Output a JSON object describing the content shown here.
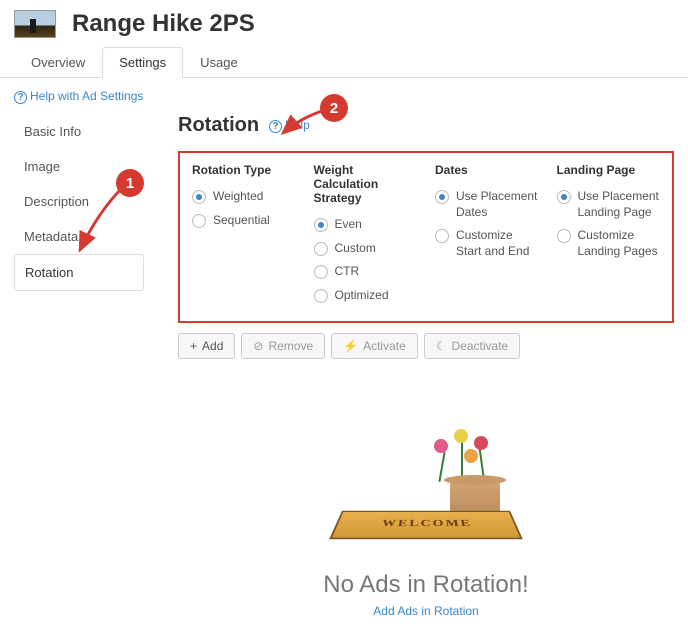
{
  "header": {
    "title": "Range Hike 2PS"
  },
  "tabs": [
    {
      "label": "Overview"
    },
    {
      "label": "Settings"
    },
    {
      "label": "Usage"
    }
  ],
  "activeTab": 1,
  "helpLink": "Help with Ad Settings",
  "sidebar": [
    {
      "label": "Basic Info"
    },
    {
      "label": "Image"
    },
    {
      "label": "Description"
    },
    {
      "label": "Metadata"
    },
    {
      "label": "Rotation"
    }
  ],
  "activeSidebar": 4,
  "section": {
    "title": "Rotation",
    "helpLabel": "Help"
  },
  "columns": {
    "rotationType": {
      "title": "Rotation Type",
      "options": [
        {
          "label": "Weighted",
          "selected": true
        },
        {
          "label": "Sequential",
          "selected": false
        }
      ]
    },
    "weightStrategy": {
      "title": "Weight Calculation Strategy",
      "options": [
        {
          "label": "Even",
          "selected": true
        },
        {
          "label": "Custom",
          "selected": false
        },
        {
          "label": "CTR",
          "selected": false
        },
        {
          "label": "Optimized",
          "selected": false
        }
      ]
    },
    "dates": {
      "title": "Dates",
      "options": [
        {
          "label": "Use Placement Dates",
          "selected": true
        },
        {
          "label": "Customize Start and End",
          "selected": false
        }
      ]
    },
    "landingPage": {
      "title": "Landing Page",
      "options": [
        {
          "label": "Use Placement Landing Page",
          "selected": true
        },
        {
          "label": "Customize Landing Pages",
          "selected": false
        }
      ]
    }
  },
  "actions": {
    "add": "Add",
    "remove": "Remove",
    "activate": "Activate",
    "deactivate": "Deactivate"
  },
  "empty": {
    "matLetters": [
      "W",
      "E",
      "L",
      "C",
      "O",
      "M",
      "E"
    ],
    "heading": "No Ads in Rotation!",
    "link": "Add Ads in Rotation"
  },
  "annotations": {
    "a1": "1",
    "a2": "2"
  }
}
